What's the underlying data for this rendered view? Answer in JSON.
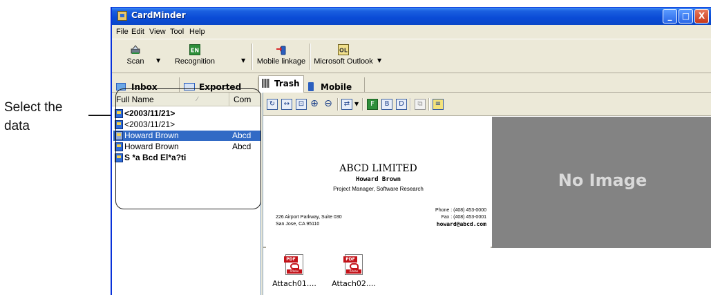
{
  "annotation": {
    "line1": "Select the",
    "line2": "data"
  },
  "window": {
    "title": "CardMinder",
    "controls": {
      "minimize": "_",
      "maximize": "□",
      "close": "X"
    }
  },
  "menu": [
    "File",
    "Edit",
    "View",
    "Tool",
    "Help"
  ],
  "toolbar": {
    "scan": "Scan",
    "recognition": "Recognition",
    "recognition_badge": "EN",
    "mobile_linkage": "Mobile linkage",
    "outlook": "Microsoft Outlook",
    "outlook_badge": "OL"
  },
  "tabs": [
    "Inbox",
    "Exported",
    "Trash",
    "Mobile"
  ],
  "list": {
    "columns": [
      "Full Name",
      "Com"
    ],
    "rows": [
      {
        "name": "<2003/11/21>",
        "company": ""
      },
      {
        "name": "<2003/11/21>",
        "company": ""
      },
      {
        "name": "Howard Brown",
        "company": "Abcd"
      },
      {
        "name": "Howard Brown",
        "company": "Abcd"
      },
      {
        "name": "S *a Bcd El*a?ti",
        "company": ""
      }
    ]
  },
  "card": {
    "company": "ABCD LIMITED",
    "name": "Howard Brown",
    "role": "Project Manager, Software Research",
    "address1": "226 Airport Parkway, Suite 030",
    "address2": "San Jose, CA 95110",
    "phone": "Phone : (408) 453-0000",
    "fax": "Fax : (408) 453-0001",
    "email": "howard@abcd.com"
  },
  "no_image": "No Image",
  "attachments": [
    {
      "label": "Attach01....",
      "badge": "PDF",
      "brand": "Adobe"
    },
    {
      "label": "Attach02....",
      "badge": "PDF",
      "brand": "Adobe"
    }
  ],
  "colors": {
    "titlebar": "#0a4bd6",
    "selection": "#316ac5",
    "window_bg": "#ece9d8"
  }
}
